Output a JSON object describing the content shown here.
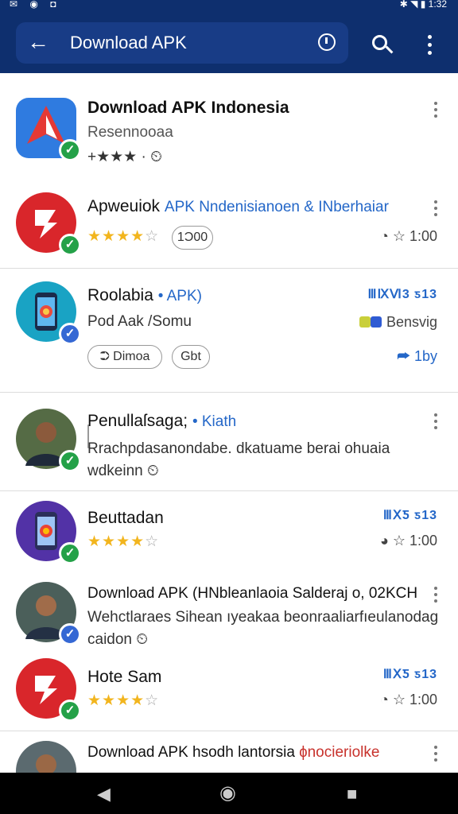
{
  "appbar": {
    "query": "Download APK"
  },
  "items": [
    {
      "title": "Download APK Indonesia",
      "subtitle": "Resennooaa",
      "meta": "+★★★ · ⏲",
      "badge": "green",
      "icon_color": "#2f7be0"
    },
    {
      "title": "Apweuiok",
      "title_accent": "APK Nndenisianoen & INberhaiar",
      "stars": "★★★★",
      "stars_empty": "☆",
      "pill": "1Ɔ00",
      "right": "◔ ☆ 1:00",
      "badge": "green",
      "icon_color": "#d9262b"
    },
    {
      "title": "Roolabia",
      "title_accent": "• APK)",
      "tag": "ⅢⅨⅥ3 ƽ13",
      "subtitle": "Pod Aak /Somu",
      "right_sub": "Bensvig",
      "pill_a": "⮊ Dimoa",
      "pill_b": "Gbt",
      "right": "⮫ 1by",
      "badge": "blue",
      "icon_color": "#19a3c4"
    },
    {
      "title": "Penullaſsaga;",
      "title_accent": "• Kiath",
      "subtitle": "Rrachpdasanondabe. dkatuame berai ohuaia",
      "subtitle2": "wdkeinn ⏲",
      "badge": "green",
      "icon_color": "#556b45"
    },
    {
      "title": "Beuttadan",
      "tag": "ⅢⅩƼ ƽ13",
      "stars": "★★★★",
      "stars_empty": "☆",
      "right": "◕ ☆ 1:00",
      "badge": "green",
      "icon_color": "#5232a6"
    },
    {
      "title": "Download APK (HNbleanlaoia Salderaj o, 02KCH",
      "subtitle": "Wehctlaraes Sihean ıyeakaa beonraaliarfıeulanodag",
      "subtitle2": "caidon ⏲",
      "badge": "blue",
      "icon_color": "#4b5f5a"
    },
    {
      "title": "Hote Sam",
      "tag": "ⅢⅩƼ ƽ13",
      "stars": "★★★★",
      "stars_empty": "☆",
      "right": "◔ ☆ 1:00",
      "badge": "green",
      "icon_color": "#d9262b"
    },
    {
      "title": "Download APK  hsodh lantorsia",
      "title_accent": "ɸnocieriolke",
      "badge": "green",
      "icon_color": "#5b6a6f"
    }
  ],
  "navbar": {
    "back": "◀",
    "home": "◉",
    "recents": "■"
  }
}
